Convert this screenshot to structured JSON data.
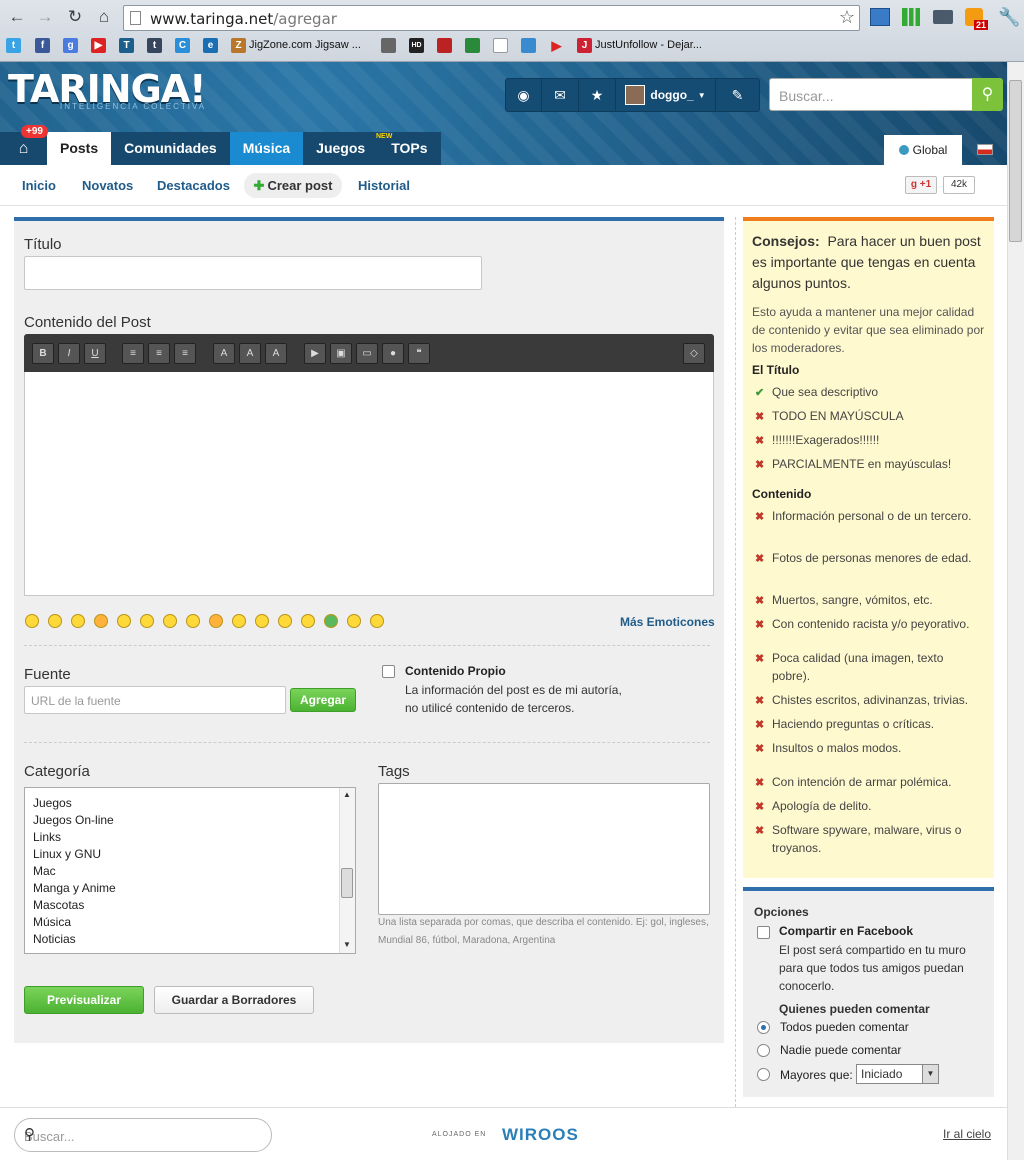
{
  "browser": {
    "url_host": "www.taringa.net",
    "url_path": "/agregar",
    "bookmarks": [
      "JigZone.com Jigsaw ...",
      "JustUnfollow - Dejar..."
    ],
    "notif_count": "21"
  },
  "header": {
    "logo": "TARINGA!",
    "logo_sub": "INTELIGENCIA COLECTIVA",
    "username": "doggo_",
    "search_placeholder": "Buscar..."
  },
  "tabs": {
    "badge": "+99",
    "items": [
      "Posts",
      "Comunidades",
      "Música",
      "Juegos",
      "TOPs"
    ],
    "new_tag": "NEW",
    "global": "Global"
  },
  "subnav": {
    "items": [
      "Inicio",
      "Novatos",
      "Destacados",
      "Crear post",
      "Historial"
    ],
    "gplus": "+1",
    "gcount": "42k"
  },
  "form": {
    "titulo_label": "Título",
    "contenido_label": "Contenido del Post",
    "toolbar": [
      "B",
      "I",
      "U"
    ],
    "mas_emociones": "Más Emoticones",
    "fuente_label": "Fuente",
    "fuente_placeholder": "URL de la fuente",
    "agregar": "Agregar",
    "propio_title": "Contenido Propio",
    "propio_text": "La información del post es de mi autoría, no utilicé contenido de terceros.",
    "categoria_label": "Categoría",
    "categorias": [
      "Juegos",
      "Juegos On-line",
      "Links",
      "Linux y GNU",
      "Mac",
      "Manga y Anime",
      "Mascotas",
      "Música",
      "Noticias"
    ],
    "tags_label": "Tags",
    "tags_help": "Una lista separada por comas, que describa el contenido. Ej: gol, ingleses, Mundial 86, fútbol, Maradona, Argentina",
    "previsualizar": "Previsualizar",
    "guardar": "Guardar a Borradores"
  },
  "tips": {
    "head": "Consejos:",
    "head_text": "Para hacer un buen post es importante que tengas en cuenta algunos puntos.",
    "intro": "Esto ayuda a mantener una mejor calidad de contenido y evitar que sea eliminado por los moderadores.",
    "titulo_head": "El Título",
    "titulo_items": [
      "Que sea descriptivo",
      "TODO EN MAYÚSCULA",
      "!!!!!!!Exagerados!!!!!!",
      "PARCIALMENTE en mayúsculas!"
    ],
    "contenido_head": "Contenido",
    "contenido_items": [
      "Información personal o de un tercero.",
      "Fotos de personas menores de edad.",
      "Muertos, sangre, vómitos, etc.",
      "Con contenido racista y/o peyorativo.",
      "Poca calidad (una imagen, texto pobre).",
      "Chistes escritos, adivinanzas, trivias.",
      "Haciendo preguntas o críticas.",
      "Insultos o malos modos.",
      "Con intención de armar polémica.",
      "Apología de delito.",
      "Software spyware, malware, virus o troyanos."
    ]
  },
  "options": {
    "title": "Opciones",
    "facebook": "Compartir en Facebook",
    "facebook_text": "El post será compartido en tu muro para que todos tus amigos puedan conocerlo.",
    "quienes": "Quienes pueden comentar",
    "r1": "Todos pueden comentar",
    "r2": "Nadie puede comentar",
    "r3": "Mayores que:",
    "mayores_value": "Iniciado"
  },
  "footer": {
    "search_placeholder": "Buscar...",
    "alojado": "ALOJADO EN",
    "host": "WIROOS",
    "ir_cielo": "Ir al cielo"
  },
  "colors": {
    "accent": "#1d5f8c",
    "green": "#5cc23a",
    "orange": "#ef7d1d",
    "tipbg": "#fff9cf"
  }
}
